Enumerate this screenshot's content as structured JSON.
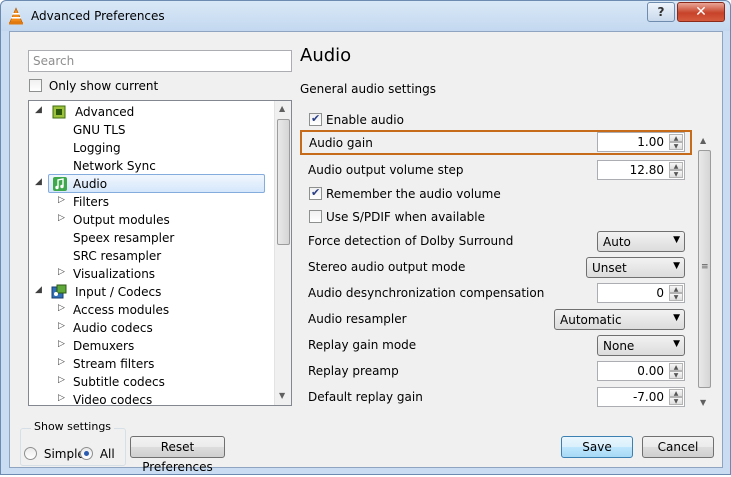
{
  "window": {
    "title": "Advanced Preferences",
    "help_label": "?",
    "close_label": "✕"
  },
  "search": {
    "placeholder": "Search"
  },
  "only_show_current": {
    "label": "Only show current",
    "checked": false
  },
  "tree": {
    "items": [
      {
        "label": "Advanced",
        "level": 0,
        "expander": "◢",
        "icon": "advanced-chip-icon"
      },
      {
        "label": "GNU TLS",
        "level": 1,
        "expander": ""
      },
      {
        "label": "Logging",
        "level": 1,
        "expander": ""
      },
      {
        "label": "Network Sync",
        "level": 1,
        "expander": ""
      },
      {
        "label": "Audio",
        "level": 0,
        "expander": "◢",
        "icon": "audio-note-icon",
        "selected": true
      },
      {
        "label": "Filters",
        "level": 1,
        "expander": "▷"
      },
      {
        "label": "Output modules",
        "level": 1,
        "expander": "▷"
      },
      {
        "label": "Speex resampler",
        "level": 1,
        "expander": ""
      },
      {
        "label": "SRC resampler",
        "level": 1,
        "expander": ""
      },
      {
        "label": "Visualizations",
        "level": 1,
        "expander": "▷"
      },
      {
        "label": "Input / Codecs",
        "level": 0,
        "expander": "◢",
        "icon": "input-codecs-icon"
      },
      {
        "label": "Access modules",
        "level": 1,
        "expander": "▷"
      },
      {
        "label": "Audio codecs",
        "level": 1,
        "expander": "▷"
      },
      {
        "label": "Demuxers",
        "level": 1,
        "expander": "▷"
      },
      {
        "label": "Stream filters",
        "level": 1,
        "expander": "▷"
      },
      {
        "label": "Subtitle codecs",
        "level": 1,
        "expander": "▷"
      },
      {
        "label": "Video codecs",
        "level": 1,
        "expander": "▷"
      }
    ]
  },
  "show_settings": {
    "legend": "Show settings",
    "simple_label": "Simple",
    "all_label": "All",
    "selected": "All"
  },
  "buttons": {
    "reset": "Reset Preferences",
    "save": "Save",
    "cancel": "Cancel"
  },
  "section": {
    "title": "Audio",
    "subtitle": "General audio settings"
  },
  "settings": {
    "enable_audio": {
      "label": "Enable audio",
      "checked": true
    },
    "audio_gain": {
      "label": "Audio gain",
      "value": "1.00"
    },
    "volume_step": {
      "label": "Audio output volume step",
      "value": "12.80"
    },
    "remember_volume": {
      "label": "Remember the audio volume",
      "checked": true
    },
    "spdif": {
      "label": "Use S/PDIF when available",
      "checked": false
    },
    "dolby": {
      "label": "Force detection of Dolby Surround",
      "value": "Auto"
    },
    "stereo_mode": {
      "label": "Stereo audio output mode",
      "value": "Unset"
    },
    "desync": {
      "label": "Audio desynchronization compensation",
      "value": "0"
    },
    "resampler": {
      "label": "Audio resampler",
      "value": "Automatic"
    },
    "replay_gain_mode": {
      "label": "Replay gain mode",
      "value": "None"
    },
    "replay_preamp": {
      "label": "Replay preamp",
      "value": "0.00"
    },
    "default_replay_gain": {
      "label": "Default replay gain",
      "value": "-7.00"
    }
  },
  "colors": {
    "highlight_border": "#c56b1a",
    "selection_border": "#84acdd",
    "title_bar": "#c9dcf1",
    "close_button": "#c7432a"
  }
}
